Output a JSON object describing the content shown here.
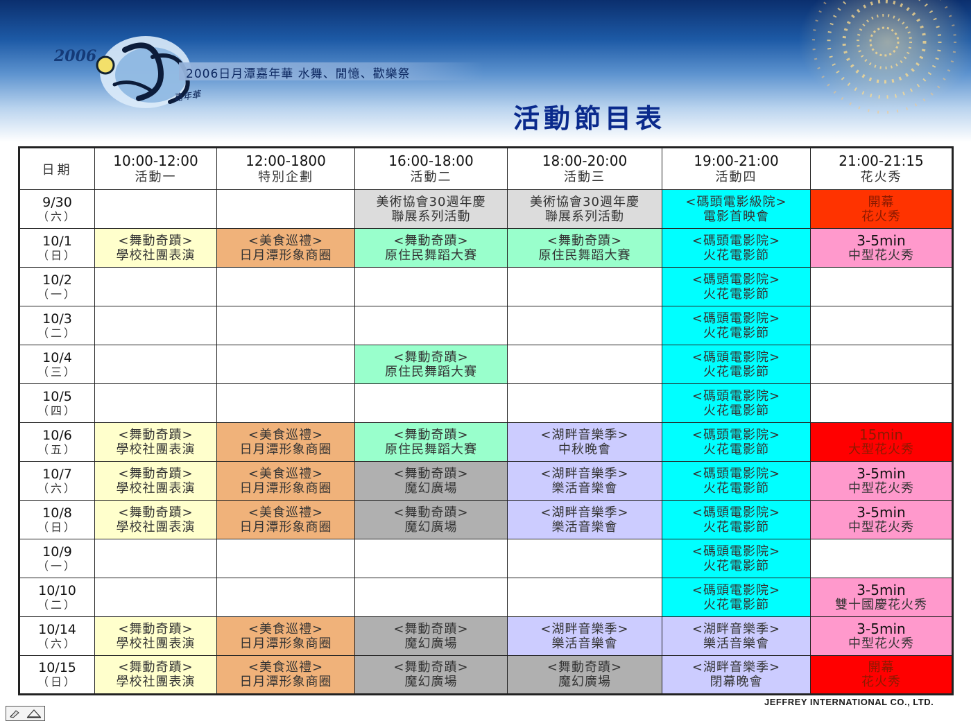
{
  "header": {
    "logo_year": "2006",
    "logo_sub": "嘉年華",
    "tagline": "2006日月潭嘉年華 水舞、閒憶、歡樂祭",
    "title": "活動節目表"
  },
  "table": {
    "date_header": "日期",
    "columns": [
      {
        "time": "10:00-12:00",
        "name": "活動一"
      },
      {
        "time": "12:00-1800",
        "name": "特別企劃"
      },
      {
        "time": "16:00-18:00",
        "name": "活動二"
      },
      {
        "time": "18:00-20:00",
        "name": "活動三"
      },
      {
        "time": "19:00-21:00",
        "name": "活動四"
      },
      {
        "time": "21:00-21:15",
        "name": "花火秀"
      }
    ],
    "rows": [
      {
        "date": "9/30",
        "day": "（六）",
        "cells": [
          {
            "l1": "",
            "l2": "",
            "color": "white"
          },
          {
            "l1": "",
            "l2": "",
            "color": "white"
          },
          {
            "l1": "美術協會30週年慶",
            "l2": "聯展系列活動",
            "color": "lgray"
          },
          {
            "l1": "美術協會30週年慶",
            "l2": "聯展系列活動",
            "color": "lgray"
          },
          {
            "l1": "<碼頭電影級院>",
            "l2": "電影首映會",
            "color": "cyan"
          },
          {
            "l1": "開幕",
            "l2": "花火秀",
            "color": "red"
          }
        ]
      },
      {
        "date": "10/1",
        "day": "（日）",
        "cells": [
          {
            "l1": "<舞動奇蹟>",
            "l2": "學校社團表演",
            "color": "yellow"
          },
          {
            "l1": "<美食巡禮>",
            "l2": "日月潭形象商圈",
            "color": "orange"
          },
          {
            "l1": "<舞動奇蹟>",
            "l2": "原住民舞蹈大賽",
            "color": "green"
          },
          {
            "l1": "<舞動奇蹟>",
            "l2": "原住民舞蹈大賽",
            "color": "green"
          },
          {
            "l1": "<碼頭電影院>",
            "l2": "火花電影節",
            "color": "cyan"
          },
          {
            "l1": "3-5min",
            "l2": "中型花火秀",
            "color": "pink"
          }
        ]
      },
      {
        "date": "10/2",
        "day": "（一）",
        "cells": [
          {
            "l1": "",
            "l2": "",
            "color": "white"
          },
          {
            "l1": "",
            "l2": "",
            "color": "white"
          },
          {
            "l1": "",
            "l2": "",
            "color": "white"
          },
          {
            "l1": "",
            "l2": "",
            "color": "white"
          },
          {
            "l1": "<碼頭電影院>",
            "l2": "火花電影節",
            "color": "cyan"
          },
          {
            "l1": "",
            "l2": "",
            "color": "white"
          }
        ]
      },
      {
        "date": "10/3",
        "day": "（二）",
        "cells": [
          {
            "l1": "",
            "l2": "",
            "color": "white"
          },
          {
            "l1": "",
            "l2": "",
            "color": "white"
          },
          {
            "l1": "",
            "l2": "",
            "color": "white"
          },
          {
            "l1": "",
            "l2": "",
            "color": "white"
          },
          {
            "l1": "<碼頭電影院>",
            "l2": "火花電影節",
            "color": "cyan"
          },
          {
            "l1": "",
            "l2": "",
            "color": "white"
          }
        ]
      },
      {
        "date": "10/4",
        "day": "（三）",
        "cells": [
          {
            "l1": "",
            "l2": "",
            "color": "white"
          },
          {
            "l1": "",
            "l2": "",
            "color": "white"
          },
          {
            "l1": "<舞動奇蹟>",
            "l2": "原住民舞蹈大賽",
            "color": "green"
          },
          {
            "l1": "",
            "l2": "",
            "color": "white"
          },
          {
            "l1": "<碼頭電影院>",
            "l2": "火花電影節",
            "color": "cyan"
          },
          {
            "l1": "",
            "l2": "",
            "color": "white"
          }
        ]
      },
      {
        "date": "10/5",
        "day": "（四）",
        "cells": [
          {
            "l1": "",
            "l2": "",
            "color": "white"
          },
          {
            "l1": "",
            "l2": "",
            "color": "white"
          },
          {
            "l1": "",
            "l2": "",
            "color": "white"
          },
          {
            "l1": "",
            "l2": "",
            "color": "white"
          },
          {
            "l1": "<碼頭電影院>",
            "l2": "火花電影節",
            "color": "cyan"
          },
          {
            "l1": "",
            "l2": "",
            "color": "white"
          }
        ]
      },
      {
        "date": "10/6",
        "day": "（五）",
        "cells": [
          {
            "l1": "<舞動奇蹟>",
            "l2": "學校社團表演",
            "color": "yellow"
          },
          {
            "l1": "<美食巡禮>",
            "l2": "日月潭形象商圈",
            "color": "orange"
          },
          {
            "l1": "<舞動奇蹟>",
            "l2": "原住民舞蹈大賽",
            "color": "green"
          },
          {
            "l1": "<湖畔音樂季>",
            "l2": "中秋晚會",
            "color": "purple"
          },
          {
            "l1": "<碼頭電影院>",
            "l2": "火花電影節",
            "color": "cyan"
          },
          {
            "l1": "15min",
            "l2": "大型花火秀",
            "color": "dred"
          }
        ]
      },
      {
        "date": "10/7",
        "day": "（六）",
        "cells": [
          {
            "l1": "<舞動奇蹟>",
            "l2": "學校社團表演",
            "color": "yellow"
          },
          {
            "l1": "<美食巡禮>",
            "l2": "日月潭形象商圈",
            "color": "orange"
          },
          {
            "l1": "<舞動奇蹟>",
            "l2": "魔幻廣場",
            "color": "gray"
          },
          {
            "l1": "<湖畔音樂季>",
            "l2": "樂活音樂會",
            "color": "purple"
          },
          {
            "l1": "<碼頭電影院>",
            "l2": "火花電影節",
            "color": "cyan"
          },
          {
            "l1": "3-5min",
            "l2": "中型花火秀",
            "color": "pink"
          }
        ]
      },
      {
        "date": "10/8",
        "day": "（日）",
        "cells": [
          {
            "l1": "<舞動奇蹟>",
            "l2": "學校社團表演",
            "color": "yellow"
          },
          {
            "l1": "<美食巡禮>",
            "l2": "日月潭形象商圈",
            "color": "orange"
          },
          {
            "l1": "<舞動奇蹟>",
            "l2": "魔幻廣場",
            "color": "gray"
          },
          {
            "l1": "<湖畔音樂季>",
            "l2": "樂活音樂會",
            "color": "purple"
          },
          {
            "l1": "<碼頭電影院>",
            "l2": "火花電影節",
            "color": "cyan"
          },
          {
            "l1": "3-5min",
            "l2": "中型花火秀",
            "color": "pink"
          }
        ]
      },
      {
        "date": "10/9",
        "day": "（一）",
        "cells": [
          {
            "l1": "",
            "l2": "",
            "color": "white"
          },
          {
            "l1": "",
            "l2": "",
            "color": "white"
          },
          {
            "l1": "",
            "l2": "",
            "color": "white"
          },
          {
            "l1": "",
            "l2": "",
            "color": "white"
          },
          {
            "l1": "<碼頭電影院>",
            "l2": "火花電影節",
            "color": "cyan"
          },
          {
            "l1": "",
            "l2": "",
            "color": "white"
          }
        ]
      },
      {
        "date": "10/10",
        "day": "（二）",
        "cells": [
          {
            "l1": "",
            "l2": "",
            "color": "white"
          },
          {
            "l1": "",
            "l2": "",
            "color": "white"
          },
          {
            "l1": "",
            "l2": "",
            "color": "white"
          },
          {
            "l1": "",
            "l2": "",
            "color": "white"
          },
          {
            "l1": "<碼頭電影院>",
            "l2": "火花電影節",
            "color": "cyan"
          },
          {
            "l1": "3-5min",
            "l2": "雙十國慶花火秀",
            "color": "pink"
          }
        ]
      },
      {
        "date": "10/14",
        "day": "（六）",
        "cells": [
          {
            "l1": "<舞動奇蹟>",
            "l2": "學校社團表演",
            "color": "yellow"
          },
          {
            "l1": "<美食巡禮>",
            "l2": "日月潭形象商圈",
            "color": "orange"
          },
          {
            "l1": "<舞動奇蹟>",
            "l2": "魔幻廣場",
            "color": "gray"
          },
          {
            "l1": "<湖畔音樂季>",
            "l2": "樂活音樂會",
            "color": "purple"
          },
          {
            "l1": "<湖畔音樂季>",
            "l2": "樂活音樂會",
            "color": "purple"
          },
          {
            "l1": "3-5min",
            "l2": "中型花火秀",
            "color": "pink"
          }
        ]
      },
      {
        "date": "10/15",
        "day": "（日）",
        "cells": [
          {
            "l1": "<舞動奇蹟>",
            "l2": "學校社團表演",
            "color": "yellow"
          },
          {
            "l1": "<美食巡禮>",
            "l2": "日月潭形象商圈",
            "color": "orange"
          },
          {
            "l1": "<舞動奇蹟>",
            "l2": "魔幻廣場",
            "color": "gray"
          },
          {
            "l1": "<舞動奇蹟>",
            "l2": "魔幻廣場",
            "color": "gray"
          },
          {
            "l1": "<湖畔音樂季>",
            "l2": "閉幕晚會",
            "color": "purple"
          },
          {
            "l1": "開幕",
            "l2": "花火秀",
            "color": "dred"
          }
        ]
      }
    ]
  },
  "footer": {
    "company": "JEFFREY INTERNATIONAL CO., LTD.",
    "nav_icons": [
      "slide-pen-icon",
      "slide-triangle-icon"
    ]
  }
}
